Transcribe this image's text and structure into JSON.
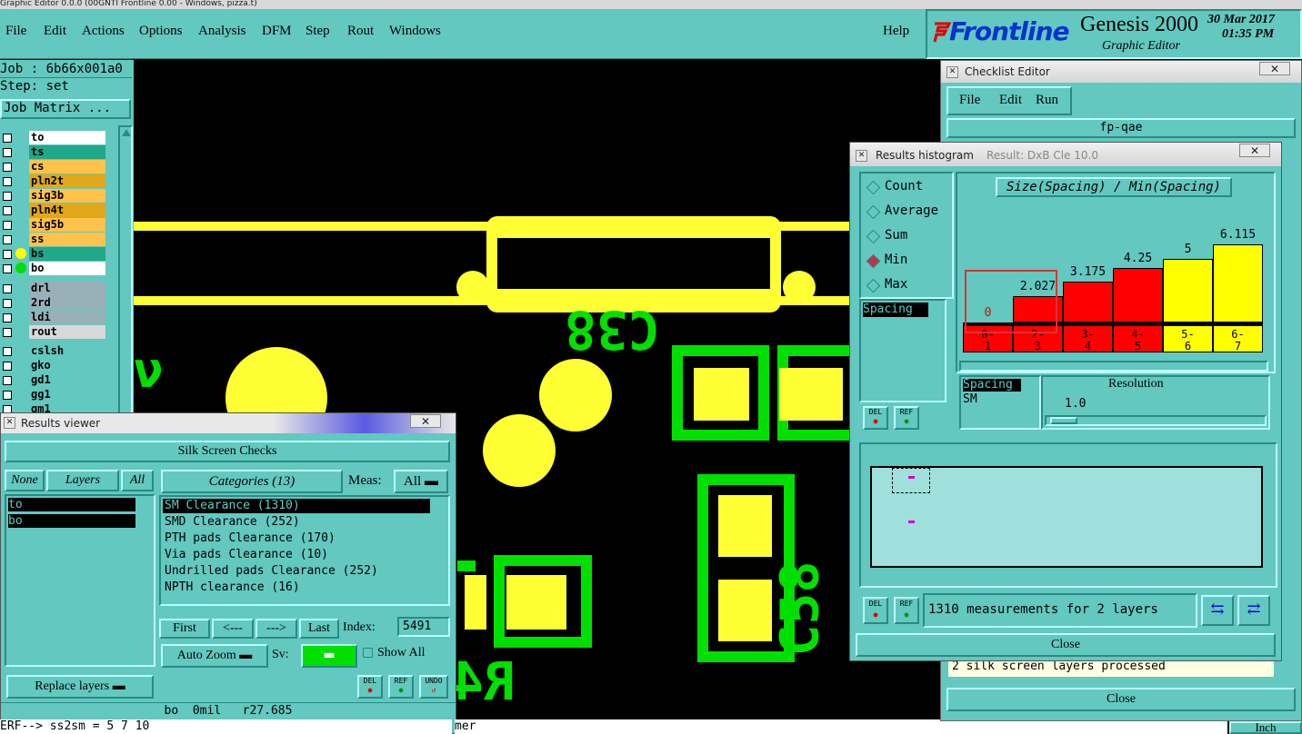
{
  "window_title": "Graphic Editor 0.0.0 (00GNTI Frontline 0.00 - Windows, pizza.t)",
  "menubar": {
    "items": [
      "File",
      "Edit",
      "Actions",
      "Options",
      "Analysis",
      "DFM",
      "Step",
      "Rout",
      "Windows"
    ],
    "help": "Help",
    "brand": "Frontline",
    "product": "Genesis 2000",
    "subtitle": "Graphic Editor",
    "date": "30 Mar 2017",
    "time": "01:35 PM"
  },
  "left_panel": {
    "job": "Job : 6b66x001a0",
    "step": "Step: set",
    "job_matrix": "Job Matrix ...",
    "layers": [
      {
        "name": "to",
        "color": "#ffffff",
        "dot": ""
      },
      {
        "name": "ts",
        "color": "#1fa88a",
        "dot": ""
      },
      {
        "name": "cs",
        "color": "#ffc24a",
        "dot": ""
      },
      {
        "name": "pln2t",
        "color": "#e0a81a",
        "dot": ""
      },
      {
        "name": "sig3b",
        "color": "#ffc24a",
        "dot": ""
      },
      {
        "name": "pln4t",
        "color": "#e0a81a",
        "dot": ""
      },
      {
        "name": "sig5b",
        "color": "#ffc24a",
        "dot": ""
      },
      {
        "name": "ss",
        "color": "#ffc24a",
        "dot": ""
      },
      {
        "name": "bs",
        "color": "#1fa88a",
        "dot": "#ffff00"
      },
      {
        "name": "bo",
        "color": "#ffffff",
        "dot": "#00e000"
      }
    ],
    "layers2": [
      {
        "name": "drl",
        "color": "#9ab0b8"
      },
      {
        "name": "2rd",
        "color": "#9ab0b8"
      },
      {
        "name": "ldi",
        "color": "#9ab0b8"
      },
      {
        "name": "rout",
        "color": "#d8d8d8"
      }
    ],
    "layers3": [
      {
        "name": "cslsh",
        "color": "#62c8c0"
      },
      {
        "name": "gko",
        "color": "#62c8c0"
      },
      {
        "name": "gd1",
        "color": "#62c8c0"
      },
      {
        "name": "gg1",
        "color": "#62c8c0"
      },
      {
        "name": "gm1",
        "color": "#62c8c0"
      }
    ]
  },
  "canvas": {
    "labels": {
      "c38": "C38",
      "c58": "C58",
      "r4": "R4",
      "n5": "ν"
    }
  },
  "results_viewer": {
    "title": "Results viewer",
    "header": "Silk Screen Checks",
    "none_btn": "None",
    "layers_btn": "Layers",
    "all_btn": "All",
    "layers": [
      "to",
      "bo"
    ],
    "categories_label": "Categories (13)",
    "meas_label": "Meas:",
    "meas_value": "All",
    "categories": [
      "SM Clearance (1310)",
      "SMD Clearance (252)",
      "PTH pads Clearance (170)",
      "Via pads Clearance (10)",
      "Undrilled pads Clearance (252)",
      "NPTH clearance (16)"
    ],
    "first": "First",
    "prev": "<---",
    "next": "--->",
    "last": "Last",
    "index_label": "Index:",
    "index_value": "5491",
    "auto_zoom": "Auto Zoom",
    "sv_label": "Sv:",
    "show_all": "Show All",
    "replace_layers": "Replace layers",
    "del": "DEL",
    "ref": "REF",
    "undo": "UNDO",
    "status": "bo  0mil   r27.685",
    "cmd_line": "ERF--> ss2sm = 5 7 10",
    "cmd_line_tail": "mer"
  },
  "checklist_editor": {
    "title": "Checklist Editor",
    "menu": [
      "File",
      "Edit",
      "Run"
    ],
    "name": "fp-qae",
    "status_line": "2 silk screen layers processed",
    "close": "Close"
  },
  "histogram": {
    "title": "Results histogram",
    "title_tail": "Result: DxB Cle 10.0",
    "modes": [
      "Count",
      "Average",
      "Sum",
      "Min",
      "Max"
    ],
    "selected_mode": "Min",
    "list_item": "Spacing",
    "chart_title": "Size(Spacing) / Min(Spacing)",
    "attr_list": [
      "Spacing",
      "SM"
    ],
    "resolution_label": "Resolution",
    "resolution_value": "1.0",
    "measurements": "1310 measurements for 2 layers",
    "close": "Close",
    "del": "DEL",
    "ref": "REF"
  },
  "chart_data": {
    "type": "bar",
    "title": "Size(Spacing) / Min(Spacing)",
    "categories": [
      "0-1",
      "2-3",
      "3-4",
      "4-5",
      "5-6",
      "6-7"
    ],
    "values": [
      0,
      2.027,
      3.175,
      4.25,
      5,
      6.115
    ],
    "value_labels": [
      "0",
      "2.027",
      "3.175",
      "4.25",
      "5",
      "6.115"
    ],
    "bar_colors": [
      "#ff0000",
      "#ff0000",
      "#ff0000",
      "#ff0000",
      "#ffff00",
      "#ffff00"
    ],
    "ylim": [
      0,
      6.115
    ],
    "grid": false
  },
  "colors": {
    "panel": "#62c8c0",
    "canvas_bg": "#000000",
    "copper": "#ffff33",
    "silk": "#00e000"
  },
  "footer": {
    "units": "Inch"
  }
}
